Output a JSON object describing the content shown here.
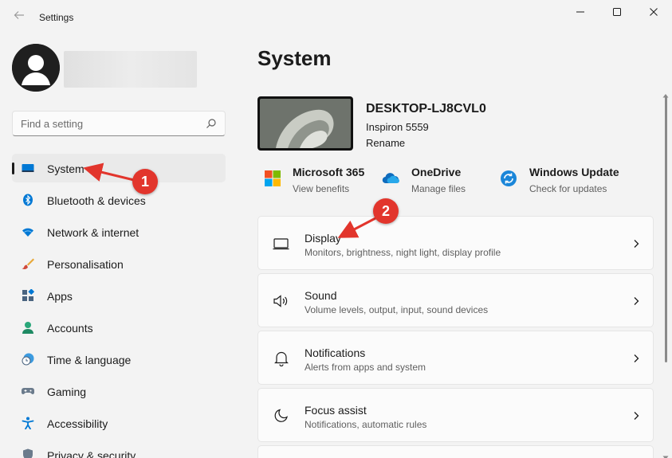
{
  "window": {
    "title": "Settings",
    "back_icon": "back-arrow-icon",
    "controls": [
      "minimize-icon",
      "maximize-icon",
      "close-icon"
    ]
  },
  "user": {
    "avatar_icon": "user-avatar-icon"
  },
  "search": {
    "placeholder": "Find a setting",
    "icon": "search-icon"
  },
  "nav": {
    "items": [
      {
        "label": "System",
        "icon": "system-display-icon",
        "active": true
      },
      {
        "label": "Bluetooth & devices",
        "icon": "bluetooth-icon"
      },
      {
        "label": "Network & internet",
        "icon": "wifi-icon"
      },
      {
        "label": "Personalisation",
        "icon": "brush-icon"
      },
      {
        "label": "Apps",
        "icon": "apps-icon"
      },
      {
        "label": "Accounts",
        "icon": "account-icon"
      },
      {
        "label": "Time & language",
        "icon": "clock-globe-icon"
      },
      {
        "label": "Gaming",
        "icon": "gamepad-icon"
      },
      {
        "label": "Accessibility",
        "icon": "accessibility-icon"
      },
      {
        "label": "Privacy & security",
        "icon": "shield-icon"
      }
    ]
  },
  "main": {
    "title": "System",
    "device": {
      "name": "DESKTOP-LJ8CVL0",
      "model": "Inspiron 5559",
      "rename": "Rename"
    },
    "quick_links": [
      {
        "title": "Microsoft 365",
        "subtitle": "View benefits",
        "icon": "microsoft-logo-icon"
      },
      {
        "title": "OneDrive",
        "subtitle": "Manage files",
        "icon": "cloud-icon"
      },
      {
        "title": "Windows Update",
        "subtitle": "Check for updates",
        "icon": "update-sync-icon"
      }
    ],
    "cards": [
      {
        "title": "Display",
        "subtitle": "Monitors, brightness, night light, display profile",
        "icon": "monitor-icon"
      },
      {
        "title": "Sound",
        "subtitle": "Volume levels, output, input, sound devices",
        "icon": "speaker-icon"
      },
      {
        "title": "Notifications",
        "subtitle": "Alerts from apps and system",
        "icon": "bell-icon"
      },
      {
        "title": "Focus assist",
        "subtitle": "Notifications, automatic rules",
        "icon": "moon-icon"
      }
    ]
  },
  "annotations": [
    {
      "number": "1"
    },
    {
      "number": "2"
    }
  ],
  "colors": {
    "background": "#f3f3f3",
    "card": "#fbfbfb",
    "annotation_red": "#e2352c",
    "accent_blue": "#0067c0"
  }
}
